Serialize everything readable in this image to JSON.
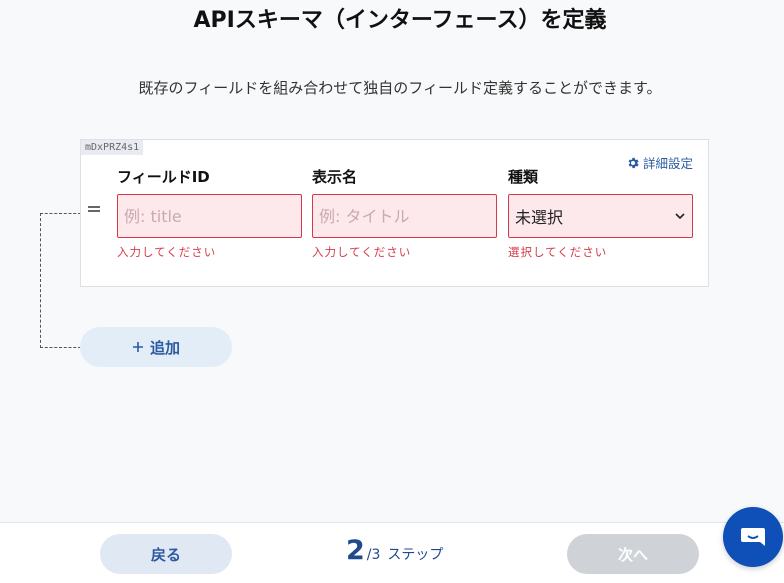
{
  "page": {
    "title": "APIスキーマ（インターフェース）を定義",
    "description": "既存のフィールドを組み合わせて独自のフィールド定義することができます。"
  },
  "card": {
    "id_tag": "mDxPRZ4s1",
    "advanced_label": "詳細設定",
    "fields": {
      "field_id": {
        "label": "フィールドID",
        "value": "",
        "placeholder": "例: title",
        "error": "入力してください"
      },
      "display_name": {
        "label": "表示名",
        "value": "",
        "placeholder": "例: タイトル",
        "error": "入力してください"
      },
      "type": {
        "label": "種類",
        "selected": "未選択",
        "error": "選択してください"
      }
    }
  },
  "add_button": {
    "label": "追加"
  },
  "footer": {
    "back_label": "戻る",
    "step_current": "2",
    "step_total": "/3",
    "step_suffix": "ステップ",
    "next_label": "次へ"
  },
  "icons": {
    "gear": "gear-icon",
    "drag": "drag-handle-icon",
    "chevron": "chevron-down-icon",
    "plus": "plus-icon",
    "chat": "chat-icon"
  },
  "colors": {
    "accent": "#2c5aa0",
    "error": "#d63a4a",
    "error_bg": "#fde8ec",
    "chat": "#0f4fb8"
  }
}
